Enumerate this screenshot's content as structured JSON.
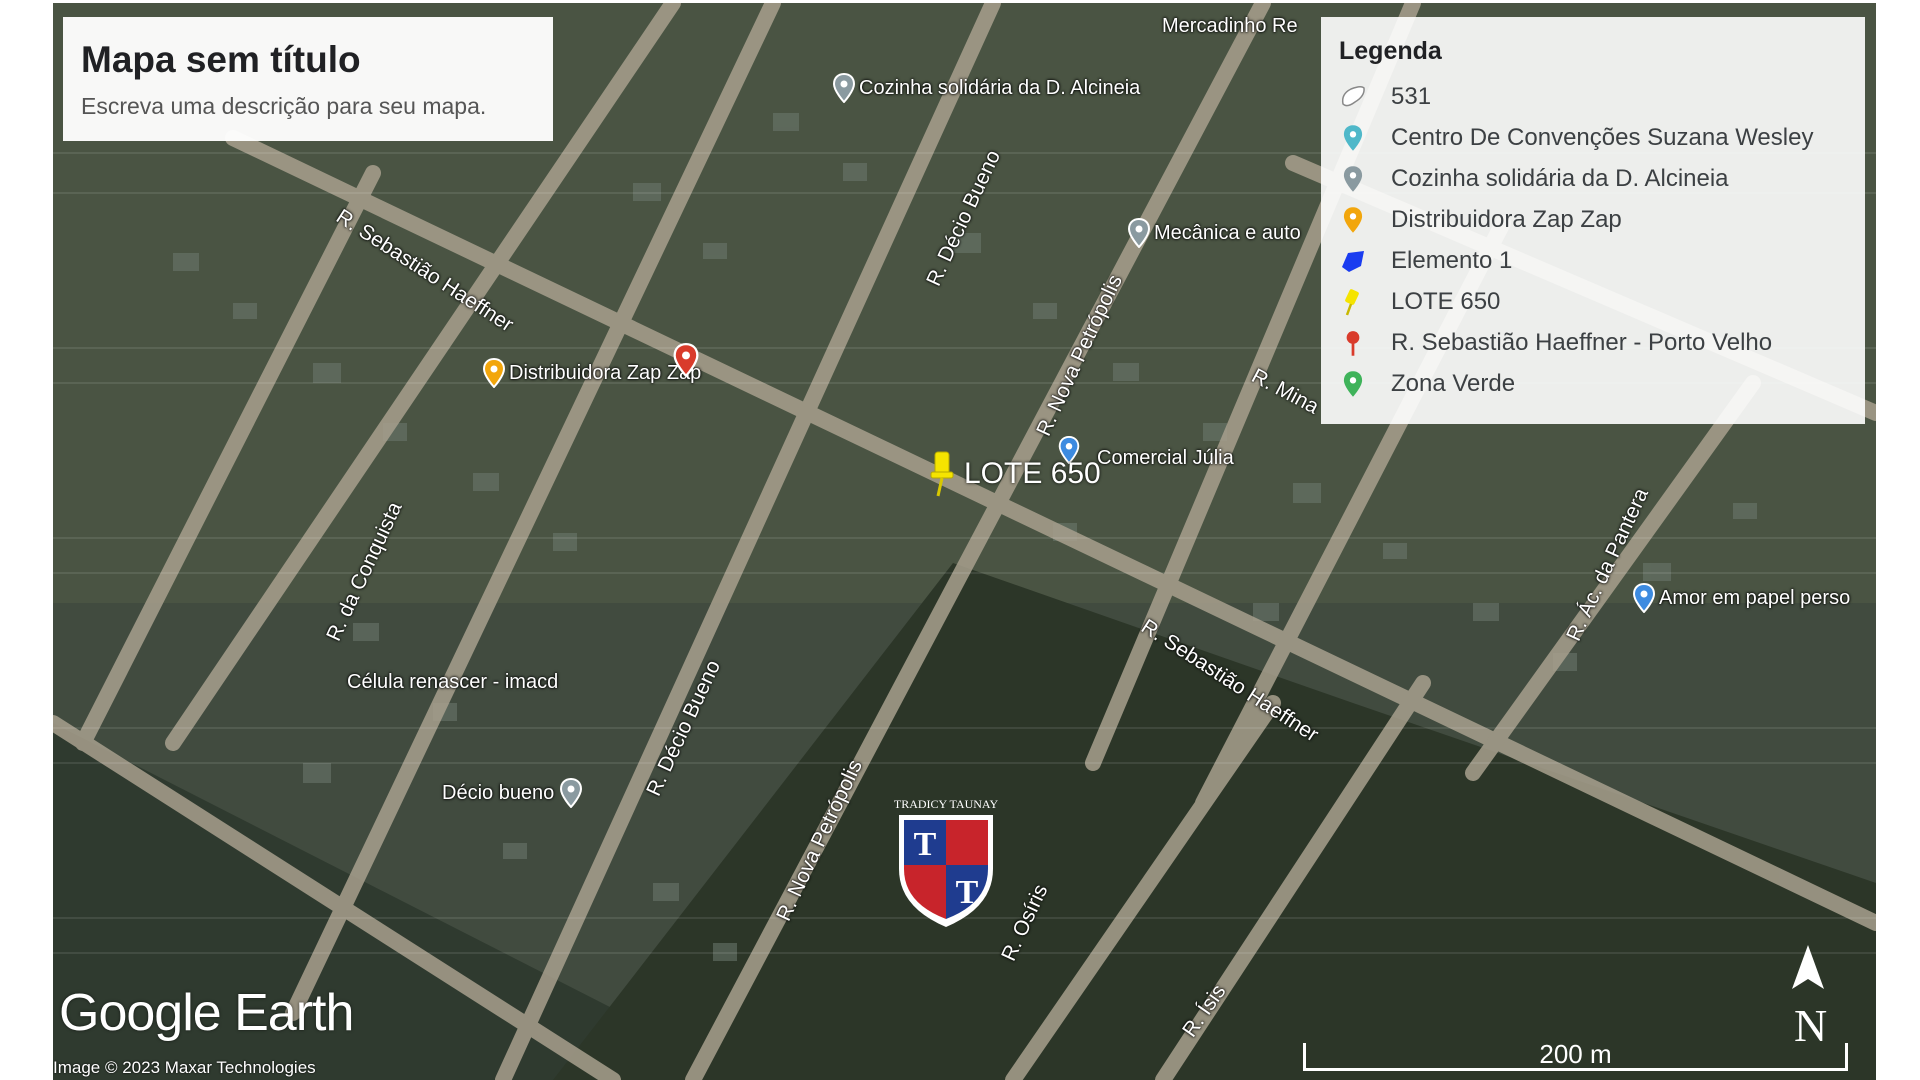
{
  "map": {
    "title": "Mapa sem título",
    "description": "Escreva uma descrição para seu mapa.",
    "legend": {
      "heading": "Legenda",
      "items": [
        {
          "label": "531",
          "icon": "polygon-outline-icon",
          "color": "#ffffff"
        },
        {
          "label": "Centro De Convenções Suzana Wesley",
          "icon": "map-pin-icon",
          "color": "#4fb8c9"
        },
        {
          "label": "Cozinha solidária da D. Alcineia",
          "icon": "map-pin-icon",
          "color": "#8a9aa0"
        },
        {
          "label": "Distribuidora Zap Zap",
          "icon": "map-pin-icon",
          "color": "#f2a60c"
        },
        {
          "label": "Elemento 1",
          "icon": "polygon-filled-icon",
          "color": "#1a3cf0"
        },
        {
          "label": "LOTE 650",
          "icon": "pushpin-icon",
          "color": "#f5e400"
        },
        {
          "label": "R. Sebastião Haeffner - Porto Velho",
          "icon": "map-pin-icon",
          "color": "#d93b2b"
        },
        {
          "label": "Zona Verde",
          "icon": "map-pin-icon",
          "color": "#3fb35a"
        }
      ]
    },
    "road_labels": [
      "R. Sebastião Haeffner",
      "R. Décio Bueno",
      "R. Nova Petrópolis",
      "R. da Conquista",
      "R. Décio Bueno",
      "R. Nova Petrópolis",
      "R. Sebastião Haeffner",
      "R. Osíris",
      "R. Ísis",
      "R. Ác. da Pantera",
      "R. Mina"
    ],
    "places": [
      {
        "label": "Cozinha solidária da D. Alcineia",
        "color": "#8a9aa0"
      },
      {
        "label": "Distribuidora Zap Zap",
        "color": "#f2a60c"
      },
      {
        "label": "Mecânica e auto",
        "color": "#8a9aa0"
      },
      {
        "label": "Comercial Júlia",
        "color": "#3d8be0"
      },
      {
        "label": "Amor em papel perso",
        "color": "#3d8be0"
      },
      {
        "label": "Célula renascer - imacd",
        "color": "#8a9aa0"
      },
      {
        "label": "Décio bueno",
        "color": "#8a9aa0"
      },
      {
        "label": "Mercadinho Re",
        "color": "#3d8be0"
      }
    ],
    "pushpin": {
      "label": "LOTE 650",
      "color": "#f5e400"
    },
    "red_pin_color": "#d93b2b",
    "watermark": "TRADICY TAUNAY",
    "watermark_letters": "T",
    "google_earth": "Google Earth",
    "attribution": "Image © 2023 Maxar Technologies",
    "scale": "200 m",
    "north": "N"
  }
}
